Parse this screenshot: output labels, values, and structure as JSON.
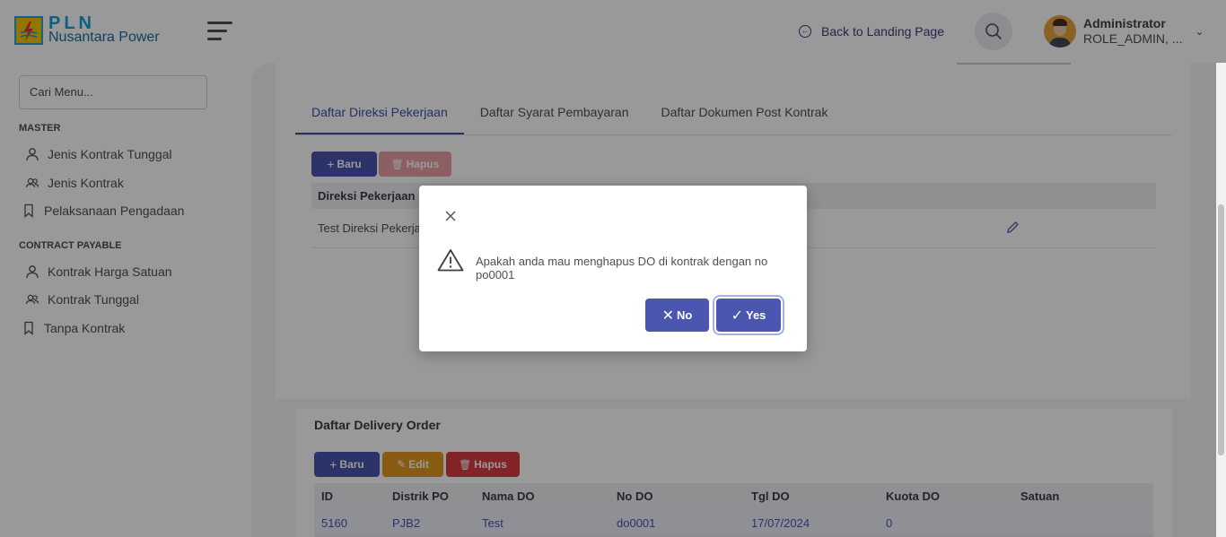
{
  "header": {
    "logo_title": "PLN",
    "logo_subtitle": "Nusantara Power",
    "back_link": "Back to Landing Page",
    "user_name": "Administrator",
    "user_role": "ROLE_ADMIN, ..."
  },
  "sidebar": {
    "search_placeholder": "Cari Menu...",
    "sections": [
      {
        "title": "MASTER",
        "items": [
          "Jenis Kontrak Tunggal",
          "Jenis Kontrak",
          "Pelaksanaan Pengadaan"
        ]
      },
      {
        "title": "CONTRACT PAYABLE",
        "items": [
          "Kontrak Harga Satuan",
          "Kontrak Tunggal",
          "Tanpa Kontrak"
        ]
      }
    ]
  },
  "tabs": [
    "Daftar Direksi Pekerjaan",
    "Daftar Syarat Pembayaran",
    "Daftar Dokumen Post Kontrak"
  ],
  "direksi": {
    "btn_new": "Baru",
    "btn_delete": "Hapus",
    "column": "Direksi Pekerjaan",
    "row_value": "Test Direksi Pekerjaan"
  },
  "delivery_order": {
    "title": "Daftar Delivery Order",
    "btn_new": "Baru",
    "btn_edit": "Edit",
    "btn_delete": "Hapus",
    "columns": [
      "ID",
      "Distrik PO",
      "Nama DO",
      "No DO",
      "Tgl DO",
      "Kuota DO",
      "Satuan"
    ],
    "rows": [
      [
        "5160",
        "PJB2",
        "Test",
        "do0001",
        "17/07/2024",
        "0",
        ""
      ]
    ]
  },
  "dialog": {
    "message": "Apakah anda mau menghapus DO di kontrak dengan no po0001",
    "no_label": "No",
    "yes_label": "Yes"
  },
  "colors": {
    "primary": "#4a56b0",
    "danger": "#d73b41",
    "warning": "#e2991e",
    "logo_yellow": "#f2c500",
    "logo_blue": "#1a9fd8"
  }
}
